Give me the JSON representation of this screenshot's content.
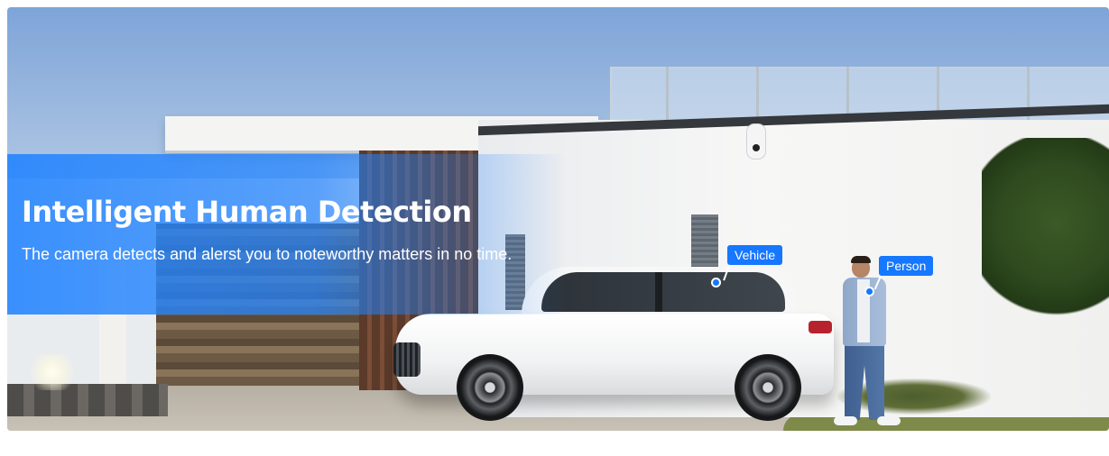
{
  "hero": {
    "title": "Intelligent Human Detection",
    "subtitle": "The camera detects and alerst you to noteworthy matters in no time.",
    "accent_color": "#1677ff",
    "tags": {
      "vehicle": "Vehicle",
      "person": "Person"
    }
  }
}
